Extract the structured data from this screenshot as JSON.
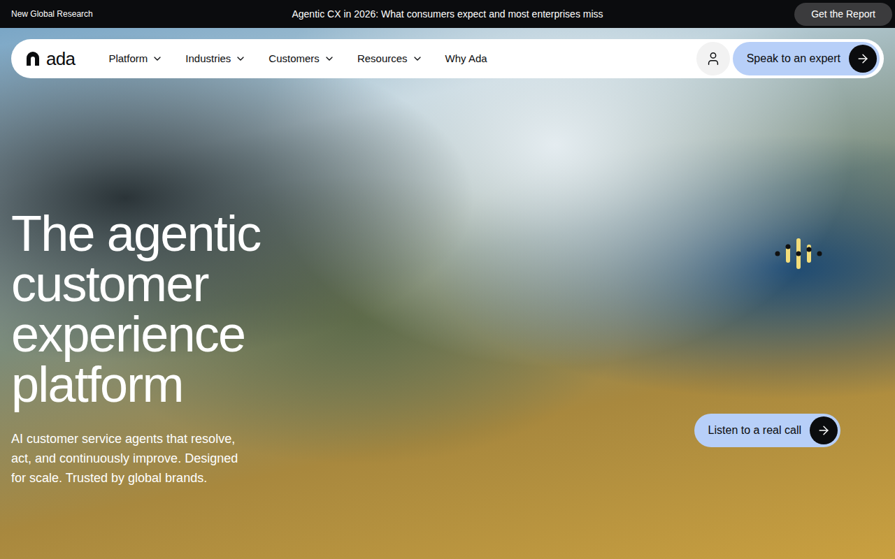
{
  "banner": {
    "label": "New Global Research",
    "headline": "Agentic CX in 2026: What consumers expect and most enterprises miss",
    "button": "Get the Report"
  },
  "nav": {
    "logo": "ada",
    "items": [
      {
        "label": "Platform",
        "has_menu": true
      },
      {
        "label": "Industries",
        "has_menu": true
      },
      {
        "label": "Customers",
        "has_menu": true
      },
      {
        "label": "Resources",
        "has_menu": true
      },
      {
        "label": "Why Ada",
        "has_menu": false
      }
    ],
    "cta": "Speak to an expert"
  },
  "hero": {
    "title": "The agentic customer experience platform",
    "subtitle": "AI customer service agents that resolve, act, and continuously improve. Designed for scale. Trusted by global brands.",
    "call_button": "Listen to a real call"
  }
}
